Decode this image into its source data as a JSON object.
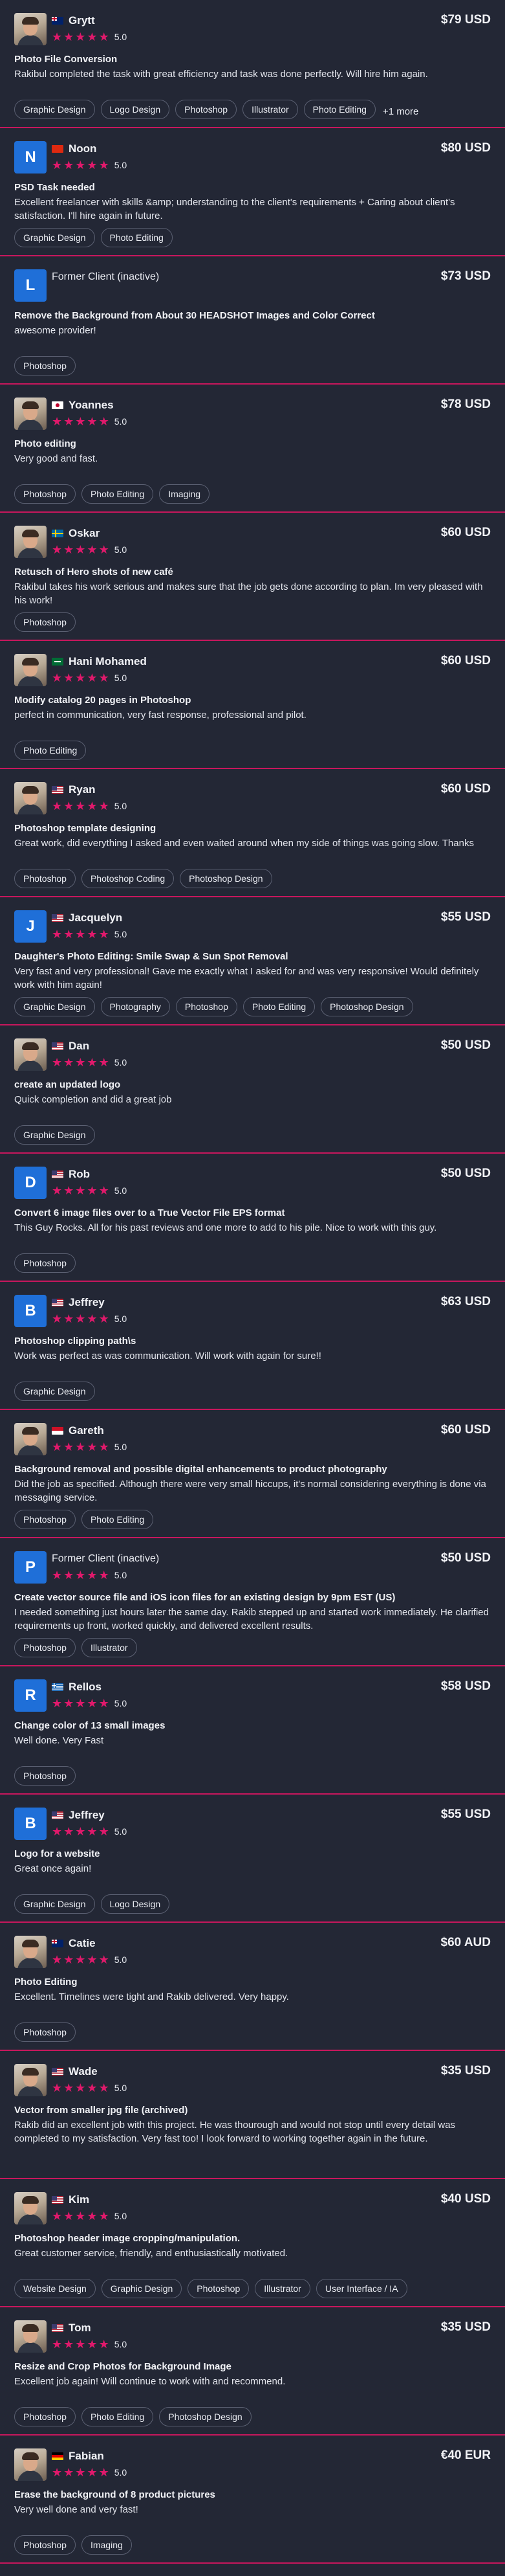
{
  "reviews": [
    {
      "name": "Grytt",
      "flag": "au",
      "flag_icon": "australia-flag-icon",
      "avatar": "photo",
      "price": "$79 USD",
      "rating": "5.0",
      "title": "Photo File Conversion",
      "text": "Rakibul completed the task with great efficiency and task was done perfectly. Will hire him again.",
      "tags": [
        "Graphic Design",
        "Logo Design",
        "Photoshop",
        "Illustrator",
        "Photo Editing"
      ],
      "more": "+1 more"
    },
    {
      "name": "Noon",
      "flag": "cn",
      "flag_icon": "flag-icon",
      "avatar": "letter",
      "letter": "N",
      "price": "$80 USD",
      "rating": "5.0",
      "title": "PSD Task needed",
      "text": "Excellent freelancer with skills &amp; understanding to the client's requirements + Caring about client's satisfaction. I'll hire again in future.",
      "tags": [
        "Graphic Design",
        "Photo Editing"
      ]
    },
    {
      "name": "Former Client (inactive)",
      "flag": "",
      "avatar": "letter",
      "letter": "L",
      "price": "$73 USD",
      "rating": "",
      "title": "Remove the Background from About 30 HEADSHOT Images and Color Correct",
      "text": "awesome provider!",
      "tags": [
        "Photoshop"
      ],
      "inactive": true
    },
    {
      "name": "Yoannes",
      "flag": "jp",
      "flag_icon": "japan-flag-icon",
      "avatar": "photo",
      "price": "$78 USD",
      "rating": "5.0",
      "title": "Photo editing",
      "text": "Very good and fast.",
      "tags": [
        "Photoshop",
        "Photo Editing",
        "Imaging"
      ]
    },
    {
      "name": "Oskar",
      "flag": "se",
      "flag_icon": "sweden-flag-icon",
      "avatar": "photo",
      "price": "$60 USD",
      "rating": "5.0",
      "title": "Retusch of Hero shots of new café",
      "text": "Rakibul takes his work serious and makes sure that the job gets done according to plan. Im very pleased with his work!",
      "tags": [
        "Photoshop"
      ]
    },
    {
      "name": "Hani Mohamed",
      "flag": "sa",
      "flag_icon": "saudi-arabia-flag-icon",
      "avatar": "photo",
      "price": "$60 USD",
      "rating": "5.0",
      "title": "Modify catalog 20 pages in Photoshop",
      "text": "perfect in communication, very fast response, professional and pilot.",
      "tags": [
        "Photo Editing"
      ]
    },
    {
      "name": "Ryan",
      "flag": "us",
      "flag_icon": "usa-flag-icon",
      "avatar": "photo",
      "price": "$60 USD",
      "rating": "5.0",
      "title": "Photoshop template designing",
      "text": "Great work, did everything I asked and even waited around when my side of things was going slow. Thanks",
      "tags": [
        "Photoshop",
        "Photoshop Coding",
        "Photoshop Design"
      ]
    },
    {
      "name": "Jacquelyn",
      "flag": "us",
      "flag_icon": "usa-flag-icon",
      "avatar": "letter",
      "letter": "J",
      "price": "$55 USD",
      "rating": "5.0",
      "title": "Daughter's Photo Editing: Smile Swap & Sun Spot Removal",
      "text": "Very fast and very professional! Gave me exactly what I asked for and was very responsive! Would definitely work with him again!",
      "tags": [
        "Graphic Design",
        "Photography",
        "Photoshop",
        "Photo Editing",
        "Photoshop Design"
      ]
    },
    {
      "name": "Dan",
      "flag": "us",
      "flag_icon": "usa-flag-icon",
      "avatar": "photo",
      "price": "$50 USD",
      "rating": "5.0",
      "title": "create an updated logo",
      "text": "Quick completion and did a great job",
      "tags": [
        "Graphic Design"
      ]
    },
    {
      "name": "Rob",
      "flag": "us",
      "flag_icon": "usa-flag-icon",
      "avatar": "letter",
      "letter": "D",
      "price": "$50 USD",
      "rating": "5.0",
      "title": "Convert 6 image files over to a True Vector File EPS format",
      "text": "This Guy Rocks. All for his past reviews and one more to add to his pile. Nice to work with this guy.",
      "tags": [
        "Photoshop"
      ]
    },
    {
      "name": "Jeffrey",
      "flag": "us",
      "flag_icon": "usa-flag-icon",
      "avatar": "letter",
      "letter": "B",
      "price": "$63 USD",
      "rating": "5.0",
      "title": "Photoshop clipping path\\s",
      "text": "Work was perfect as was communication. Will work with again for sure!!",
      "tags": [
        "Graphic Design"
      ]
    },
    {
      "name": "Gareth",
      "flag": "id",
      "flag_icon": "indonesia-flag-icon",
      "avatar": "photo",
      "price": "$60 USD",
      "rating": "5.0",
      "title": "Background removal and possible digital enhancements to product photography",
      "text": "Did the job as specified. Although there were very small hiccups, it's normal considering everything is done via messaging service.",
      "tags": [
        "Photoshop",
        "Photo Editing"
      ]
    },
    {
      "name": "Former Client (inactive)",
      "flag": "",
      "avatar": "letter",
      "letter": "P",
      "price": "$50 USD",
      "rating": "5.0",
      "title": "Create vector source file and iOS icon files for an existing design by 9pm EST (US)",
      "text": "I needed something just hours later the same day. Rakib stepped up and started work immediately. He clarified requirements up front, worked quickly, and delivered excellent results.",
      "tags": [
        "Photoshop",
        "Illustrator"
      ],
      "inactive": true
    },
    {
      "name": "Rellos",
      "flag": "gr",
      "flag_icon": "greece-flag-icon",
      "avatar": "letter",
      "letter": "R",
      "price": "$58 USD",
      "rating": "5.0",
      "title": "Change color of 13 small images",
      "text": "Well done. Very Fast",
      "tags": [
        "Photoshop"
      ]
    },
    {
      "name": "Jeffrey",
      "flag": "us",
      "flag_icon": "usa-flag-icon",
      "avatar": "letter",
      "letter": "B",
      "price": "$55 USD",
      "rating": "5.0",
      "title": "Logo for a website",
      "text": "Great once again!",
      "tags": [
        "Graphic Design",
        "Logo Design"
      ]
    },
    {
      "name": "Catie",
      "flag": "au",
      "flag_icon": "australia-flag-icon",
      "avatar": "photo",
      "price": "$60 AUD",
      "rating": "5.0",
      "title": "Photo Editing",
      "text": "Excellent. Timelines were tight and Rakib delivered. Very happy.",
      "tags": [
        "Photoshop"
      ]
    },
    {
      "name": "Wade",
      "flag": "us",
      "flag_icon": "usa-flag-icon",
      "avatar": "photo",
      "price": "$35 USD",
      "rating": "5.0",
      "title": "Vector from smaller jpg file (archived)",
      "text": "Rakib did an excellent job with this project. He was thourough and would not stop until every detail was completed to my satisfaction. Very fast too! I look forward to working together again in the future.",
      "tags": []
    },
    {
      "name": "Kim",
      "flag": "us",
      "flag_icon": "usa-flag-icon",
      "avatar": "photo",
      "price": "$40 USD",
      "rating": "5.0",
      "title": "Photoshop header image cropping/manipulation.",
      "text": "Great customer service, friendly, and enthusiastically motivated.",
      "tags": [
        "Website Design",
        "Graphic Design",
        "Photoshop",
        "Illustrator",
        "User Interface / IA"
      ]
    },
    {
      "name": "Tom",
      "flag": "us",
      "flag_icon": "usa-flag-icon",
      "avatar": "photo",
      "price": "$35 USD",
      "rating": "5.0",
      "title": "Resize and Crop Photos for Background Image",
      "text": "Excellent job again! Will continue to work with and recommend.",
      "tags": [
        "Photoshop",
        "Photo Editing",
        "Photoshop Design"
      ]
    },
    {
      "name": "Fabian",
      "flag": "de",
      "flag_icon": "germany-flag-icon",
      "avatar": "photo",
      "price": "€40 EUR",
      "rating": "5.0",
      "title": "Erase the background of 8 product pictures",
      "text": "Very well done and very fast!",
      "tags": [
        "Photoshop",
        "Imaging"
      ]
    }
  ],
  "colors": {
    "background": "#232735",
    "accent": "#e0196b",
    "divider": "#c8175d",
    "avatar_letter_bg": "#1f6fd8"
  }
}
